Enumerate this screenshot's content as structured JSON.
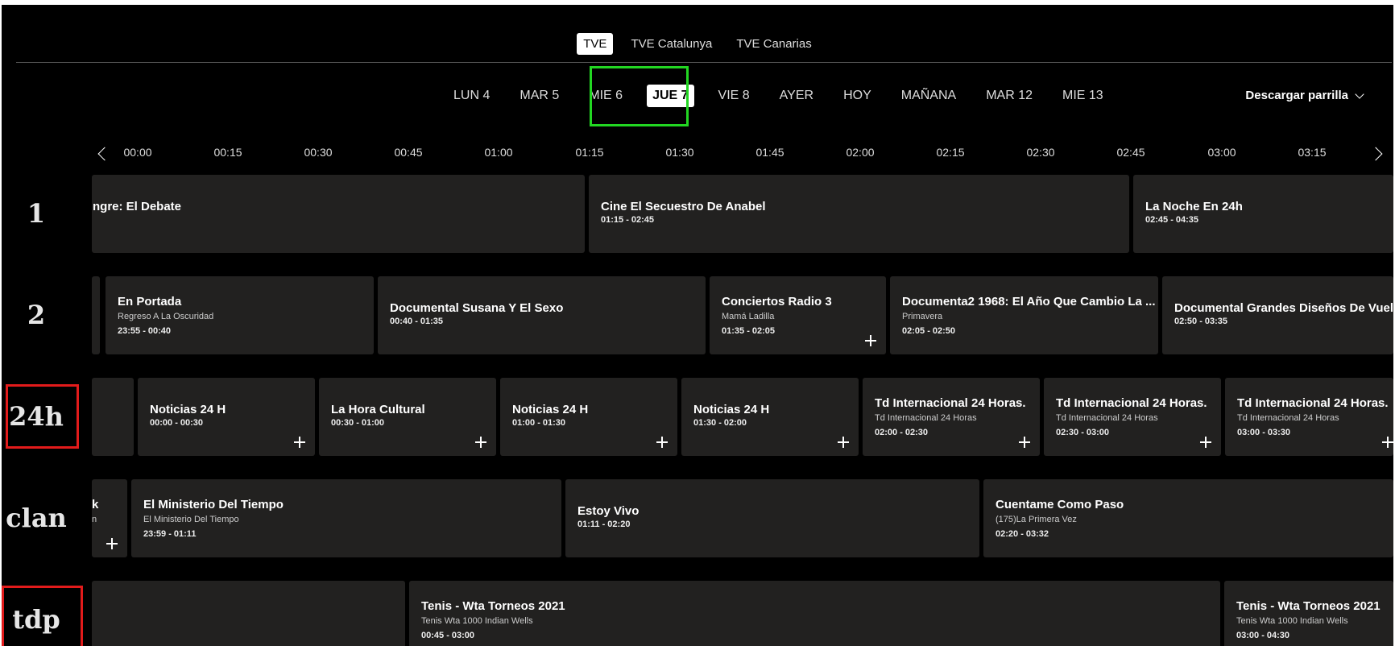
{
  "networks": [
    "TVE",
    "TVE Catalunya",
    "TVE Canarias"
  ],
  "days": [
    "LUN 4",
    "MAR 5",
    "MIE 6",
    "JUE 7",
    "VIE 8",
    "AYER",
    "HOY",
    "MAÑANA",
    "MAR 12",
    "MIE 13"
  ],
  "download_label": "Descargar parrilla",
  "times": [
    "00:00",
    "00:15",
    "00:30",
    "00:45",
    "01:00",
    "01:15",
    "01:30",
    "01:45",
    "02:00",
    "02:15",
    "02:30",
    "02:45",
    "03:00",
    "03:15"
  ],
  "channels": [
    {
      "logo": "1",
      "programs": [
        {
          "title": "ngre: El Debate",
          "time": ""
        },
        {
          "title": "Cine El Secuestro De Anabel",
          "time": "01:15 - 02:45"
        },
        {
          "title": "La Noche En 24h",
          "time": "02:45 - 04:35"
        }
      ]
    },
    {
      "logo": "2",
      "programs": [
        {
          "title": "",
          "time": ""
        },
        {
          "title": "En Portada",
          "subtitle": "Regreso A La Oscuridad",
          "time": "23:55 - 00:40"
        },
        {
          "title": "Documental Susana Y El Sexo",
          "time": "00:40 - 01:35"
        },
        {
          "title": "Conciertos Radio 3",
          "subtitle": "Mamá Ladilla",
          "time": "01:35 - 02:05"
        },
        {
          "title": "Documenta2 1968: El Año Que Cambio La ...",
          "subtitle": "Primavera",
          "time": "02:05 - 02:50"
        },
        {
          "title": "Documental Grandes Diseños De Vuelta",
          "time": "02:50 - 03:35"
        }
      ]
    },
    {
      "logo": "24h",
      "programs": [
        {
          "title": "",
          "time": ""
        },
        {
          "title": "Noticias 24 H",
          "time": "00:00 - 00:30"
        },
        {
          "title": "La Hora Cultural",
          "time": "00:30 - 01:00"
        },
        {
          "title": "Noticias 24 H",
          "time": "01:00 - 01:30"
        },
        {
          "title": "Noticias 24 H",
          "time": "01:30 - 02:00"
        },
        {
          "title": "Td Internacional 24 Horas.",
          "subtitle": "Td Internacional 24 Horas",
          "time": "02:00 - 02:30"
        },
        {
          "title": "Td Internacional 24 Horas.",
          "subtitle": "Td Internacional 24 Horas",
          "time": "02:30 - 03:00"
        },
        {
          "title": "Td Internacional 24 Horas.",
          "subtitle": "Td Internacional 24 Horas",
          "time": "03:00 - 03:30"
        }
      ]
    },
    {
      "logo": "clan",
      "programs": [
        {
          "title": "k",
          "subtitle": "n",
          "time": ""
        },
        {
          "title": "El Ministerio Del Tiempo",
          "subtitle": "El Ministerio Del Tiempo",
          "time": "23:59 - 01:11"
        },
        {
          "title": "Estoy Vivo",
          "time": "01:11 - 02:20"
        },
        {
          "title": "Cuentame Como Paso",
          "subtitle": "(175)La Primera Vez",
          "time": "02:20 - 03:32"
        }
      ]
    },
    {
      "logo": "tdp",
      "programs": [
        {
          "title": "",
          "time": ""
        },
        {
          "title": "Tenis - Wta Torneos 2021",
          "subtitle": "Tenis Wta 1000 Indian Wells",
          "time": "00:45 - 03:00"
        },
        {
          "title": "Tenis - Wta Torneos 2021",
          "subtitle": "Tenis Wta 1000 Indian Wells",
          "time": "03:00 - 04:30"
        }
      ]
    }
  ]
}
